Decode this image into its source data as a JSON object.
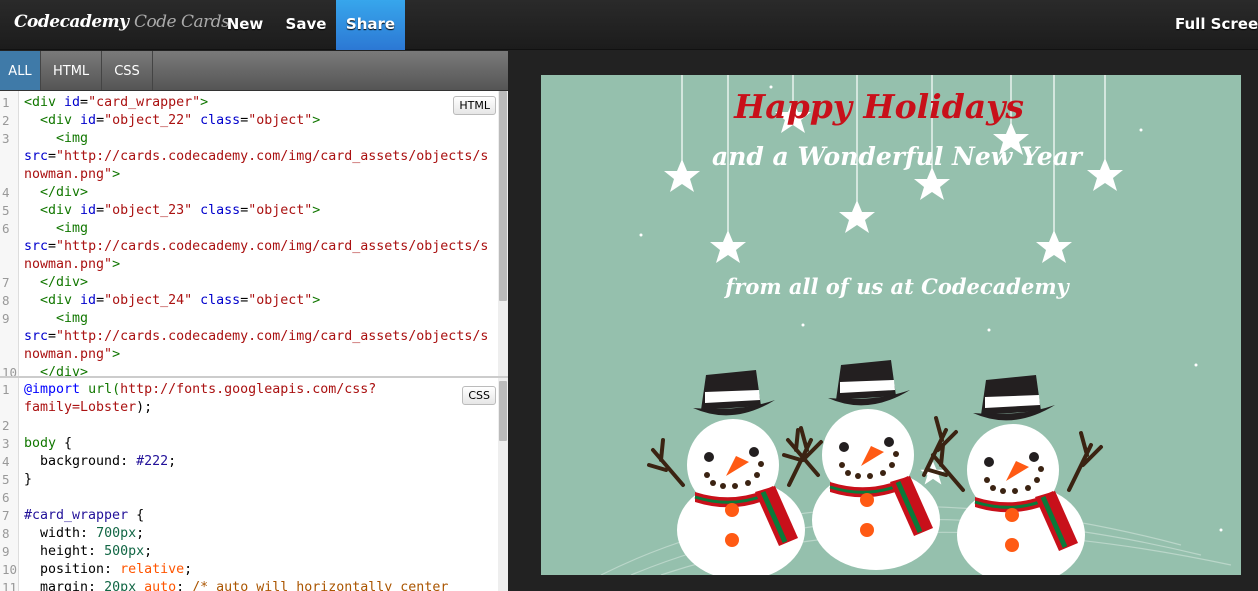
{
  "header": {
    "logo_main": "Codecademy",
    "logo_sub": "Code Cards",
    "nav": {
      "new": "New",
      "save": "Save",
      "share": "Share",
      "fullscreen": "Full Screen"
    }
  },
  "editor": {
    "tabs": [
      "ALL",
      "HTML",
      "CSS"
    ],
    "html_mode_label": "HTML",
    "css_mode_label": "CSS",
    "html_rows": [
      {
        "n": "1",
        "t": [
          [
            "tag",
            "<div "
          ],
          [
            "attr",
            "id"
          ],
          [
            "plain",
            "="
          ],
          [
            "str",
            "\"card_wrapper\""
          ],
          [
            "tag",
            ">"
          ]
        ]
      },
      {
        "n": "2",
        "t": [
          [
            "plain",
            "  "
          ],
          [
            "tag",
            "<div "
          ],
          [
            "attr",
            "id"
          ],
          [
            "plain",
            "="
          ],
          [
            "str",
            "\"object_22\""
          ],
          [
            "plain",
            " "
          ],
          [
            "attr",
            "class"
          ],
          [
            "plain",
            "="
          ],
          [
            "str",
            "\"object\""
          ],
          [
            "tag",
            ">"
          ]
        ]
      },
      {
        "n": "3",
        "t": [
          [
            "plain",
            "    "
          ],
          [
            "tag",
            "<img"
          ]
        ]
      },
      {
        "n": "",
        "t": [
          [
            "attr",
            "src"
          ],
          [
            "plain",
            "="
          ],
          [
            "str",
            "\"http://cards.codecademy.com/img/card_assets/objects/s"
          ]
        ]
      },
      {
        "n": "",
        "t": [
          [
            "str",
            "nowman.png\""
          ],
          [
            "tag",
            ">"
          ]
        ]
      },
      {
        "n": "4",
        "t": [
          [
            "plain",
            "  "
          ],
          [
            "tag",
            "</div>"
          ]
        ]
      },
      {
        "n": "5",
        "t": [
          [
            "plain",
            "  "
          ],
          [
            "tag",
            "<div "
          ],
          [
            "attr",
            "id"
          ],
          [
            "plain",
            "="
          ],
          [
            "str",
            "\"object_23\""
          ],
          [
            "plain",
            " "
          ],
          [
            "attr",
            "class"
          ],
          [
            "plain",
            "="
          ],
          [
            "str",
            "\"object\""
          ],
          [
            "tag",
            ">"
          ]
        ]
      },
      {
        "n": "6",
        "t": [
          [
            "plain",
            "    "
          ],
          [
            "tag",
            "<img"
          ]
        ]
      },
      {
        "n": "",
        "t": [
          [
            "attr",
            "src"
          ],
          [
            "plain",
            "="
          ],
          [
            "str",
            "\"http://cards.codecademy.com/img/card_assets/objects/s"
          ]
        ]
      },
      {
        "n": "",
        "t": [
          [
            "str",
            "nowman.png\""
          ],
          [
            "tag",
            ">"
          ]
        ]
      },
      {
        "n": "7",
        "t": [
          [
            "plain",
            "  "
          ],
          [
            "tag",
            "</div>"
          ]
        ]
      },
      {
        "n": "8",
        "t": [
          [
            "plain",
            "  "
          ],
          [
            "tag",
            "<div "
          ],
          [
            "attr",
            "id"
          ],
          [
            "plain",
            "="
          ],
          [
            "str",
            "\"object_24\""
          ],
          [
            "plain",
            " "
          ],
          [
            "attr",
            "class"
          ],
          [
            "plain",
            "="
          ],
          [
            "str",
            "\"object\""
          ],
          [
            "tag",
            ">"
          ]
        ]
      },
      {
        "n": "9",
        "t": [
          [
            "plain",
            "    "
          ],
          [
            "tag",
            "<img"
          ]
        ]
      },
      {
        "n": "",
        "t": [
          [
            "attr",
            "src"
          ],
          [
            "plain",
            "="
          ],
          [
            "str",
            "\"http://cards.codecademy.com/img/card_assets/objects/s"
          ]
        ]
      },
      {
        "n": "",
        "t": [
          [
            "str",
            "nowman.png\""
          ],
          [
            "tag",
            ">"
          ]
        ]
      },
      {
        "n": "10",
        "t": [
          [
            "plain",
            "  "
          ],
          [
            "tag",
            "</div>"
          ]
        ]
      }
    ],
    "css_rows": [
      {
        "n": "1",
        "t": [
          [
            "def",
            "@import"
          ],
          [
            "plain",
            " "
          ],
          [
            "tag",
            "url("
          ],
          [
            "str",
            "http://fonts.googleapis.com/css?"
          ]
        ]
      },
      {
        "n": "",
        "t": [
          [
            "str",
            "family=Lobster"
          ],
          [
            "plain",
            ");"
          ]
        ]
      },
      {
        "n": "2",
        "t": []
      },
      {
        "n": "3",
        "t": [
          [
            "tag",
            "body"
          ],
          [
            "plain",
            " {"
          ]
        ]
      },
      {
        "n": "4",
        "t": [
          [
            "plain",
            "  background: "
          ],
          [
            "atom",
            "#222"
          ],
          [
            "plain",
            ";"
          ]
        ]
      },
      {
        "n": "5",
        "t": [
          [
            "plain",
            "}"
          ]
        ]
      },
      {
        "n": "6",
        "t": []
      },
      {
        "n": "7",
        "t": [
          [
            "atom",
            "#card_wrapper"
          ],
          [
            "plain",
            " {"
          ]
        ]
      },
      {
        "n": "8",
        "t": [
          [
            "plain",
            "  width: "
          ],
          [
            "num",
            "700px"
          ],
          [
            "plain",
            ";"
          ]
        ]
      },
      {
        "n": "9",
        "t": [
          [
            "plain",
            "  height: "
          ],
          [
            "num",
            "500px"
          ],
          [
            "plain",
            ";"
          ]
        ]
      },
      {
        "n": "10",
        "t": [
          [
            "plain",
            "  position: "
          ],
          [
            "kw2",
            "relative"
          ],
          [
            "plain",
            ";"
          ]
        ]
      },
      {
        "n": "11",
        "t": [
          [
            "plain",
            "  margin: "
          ],
          [
            "num",
            "20px"
          ],
          [
            "plain",
            " "
          ],
          [
            "kw2",
            "auto"
          ],
          [
            "plain",
            "; "
          ],
          [
            "com",
            "/* auto will horizontally center"
          ]
        ]
      }
    ]
  },
  "card": {
    "line1": "Happy Holidays",
    "line2": "and a Wonderful New Year",
    "line3": "from all of us at Codecademy",
    "colors": {
      "background": "#95c0ad",
      "title": "#c8101a"
    }
  }
}
